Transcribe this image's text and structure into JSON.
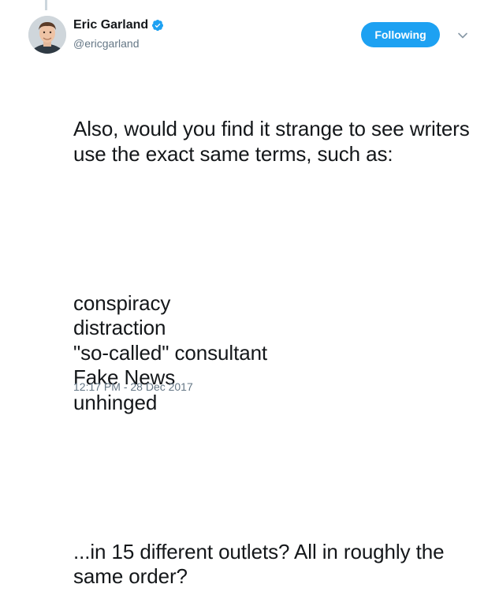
{
  "author": {
    "display_name": "Eric Garland",
    "handle": "@ericgarland",
    "verified_icon": "verified-badge-icon",
    "avatar_icon": "profile-photo"
  },
  "follow_button": {
    "label": "Following"
  },
  "menu": {
    "icon": "chevron-down-icon"
  },
  "tweet": {
    "paragraphs": [
      "Also, would you find it strange to see writers use the exact same terms, such as:",
      "conspiracy\ndistraction\n\"so-called\" consultant\nFake News\nunhinged",
      "...in 15 different outlets? All in roughly the same order?"
    ],
    "timestamp": "12:17 PM - 28 Dec 2017"
  },
  "colors": {
    "accent": "#1da1f2",
    "text": "#14171a",
    "muted": "#657786"
  }
}
